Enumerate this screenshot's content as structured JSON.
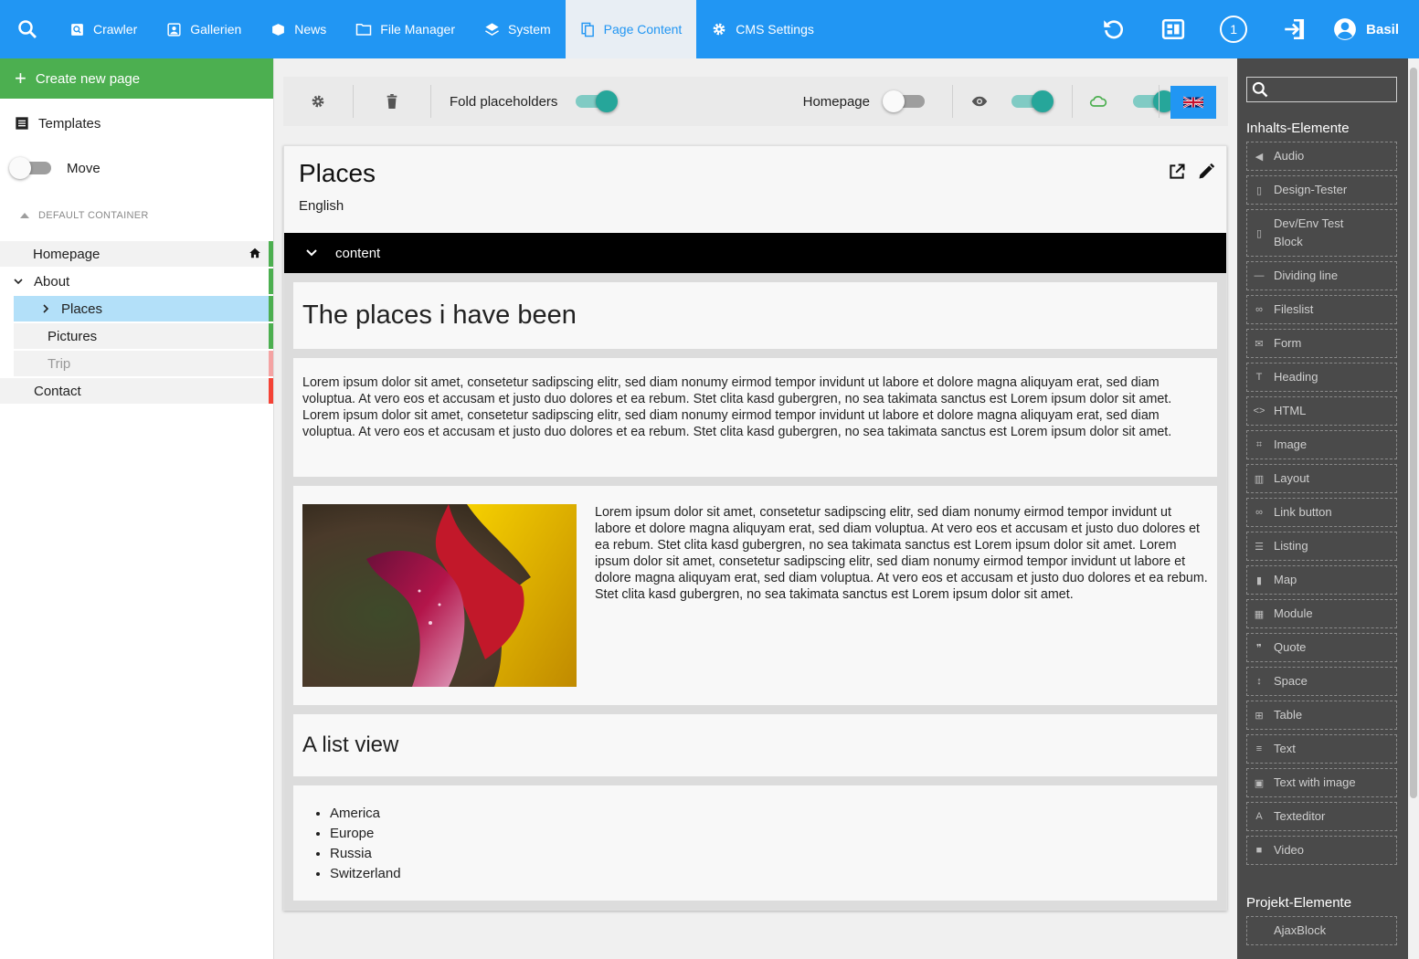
{
  "topbar": {
    "nav": [
      {
        "label": "Crawler",
        "icon": "crawler-icon"
      },
      {
        "label": "Gallerien",
        "icon": "gallery-icon"
      },
      {
        "label": "News",
        "icon": "news-icon"
      },
      {
        "label": "File Manager",
        "icon": "folder-icon"
      },
      {
        "label": "System",
        "icon": "layers-icon"
      },
      {
        "label": "Page Content",
        "icon": "pages-icon",
        "active": true
      },
      {
        "label": "CMS Settings",
        "icon": "gear-icon"
      }
    ],
    "badge_count": "1",
    "user_name": "Basil"
  },
  "sidebar": {
    "create_label": "Create new page",
    "templates_label": "Templates",
    "move_label": "Move",
    "container_label": "DEFAULT CONTAINER",
    "tree": [
      {
        "label": "Homepage"
      },
      {
        "label": "About"
      },
      {
        "label": "Places"
      },
      {
        "label": "Pictures"
      },
      {
        "label": "Trip"
      },
      {
        "label": "Contact"
      }
    ]
  },
  "toolbar": {
    "fold_label": "Fold placeholders",
    "homepage_label": "Homepage"
  },
  "page": {
    "title": "Places",
    "language": "English",
    "section": "content",
    "blocks": {
      "heading": "The places i have been",
      "text1": "Lorem ipsum dolor sit amet, consetetur sadipscing elitr, sed diam nonumy eirmod tempor invidunt ut labore et dolore magna aliquyam erat, sed diam voluptua. At vero eos et accusam et justo duo dolores et ea rebum. Stet clita kasd gubergren, no sea takimata sanctus est Lorem ipsum dolor sit amet. Lorem ipsum dolor sit amet, consetetur sadipscing elitr, sed diam nonumy eirmod tempor invidunt ut labore et dolore magna aliquyam erat, sed diam voluptua. At vero eos et accusam et justo duo dolores et ea rebum. Stet clita kasd gubergren, no sea takimata sanctus est Lorem ipsum dolor sit amet.",
      "text2": "Lorem ipsum dolor sit amet, consetetur sadipscing elitr, sed diam nonumy eirmod tempor invidunt ut labore et dolore magna aliquyam erat, sed diam voluptua. At vero eos et accusam et justo duo dolores et ea rebum. Stet clita kasd gubergren, no sea takimata sanctus est Lorem ipsum dolor sit amet. Lorem ipsum dolor sit amet, consetetur sadipscing elitr, sed diam nonumy eirmod tempor invidunt ut labore et dolore magna aliquyam erat, sed diam voluptua. At vero eos et accusam et justo duo dolores et ea rebum. Stet clita kasd gubergren, no sea takimata sanctus est Lorem ipsum dolor sit amet.",
      "subheading": "A list view",
      "list": [
        "America",
        "Europe",
        "Russia",
        "Switzerland"
      ]
    }
  },
  "panel": {
    "heading": "Inhalts-Elemente",
    "items": [
      {
        "label": "Audio",
        "icon": "volume-icon"
      },
      {
        "label": "Design-Tester",
        "icon": "tester-icon"
      },
      {
        "label": "Dev/Env Test Block",
        "icon": "tester-icon"
      },
      {
        "label": "Dividing line",
        "icon": "minus-icon"
      },
      {
        "label": "Fileslist",
        "icon": "link-icon"
      },
      {
        "label": "Form",
        "icon": "mail-icon"
      },
      {
        "label": "Heading",
        "icon": "text-size-icon"
      },
      {
        "label": "HTML",
        "icon": "code-icon"
      },
      {
        "label": "Image",
        "icon": "crop-icon"
      },
      {
        "label": "Layout",
        "icon": "columns-icon"
      },
      {
        "label": "Link button",
        "icon": "link-icon"
      },
      {
        "label": "Listing",
        "icon": "list-icon"
      },
      {
        "label": "Map",
        "icon": "map-icon"
      },
      {
        "label": "Module",
        "icon": "module-icon"
      },
      {
        "label": "Quote",
        "icon": "quote-icon"
      },
      {
        "label": "Space",
        "icon": "spacing-icon"
      },
      {
        "label": "Table",
        "icon": "table-icon"
      },
      {
        "label": "Text",
        "icon": "text-icon"
      },
      {
        "label": "Text with image",
        "icon": "text-image-icon"
      },
      {
        "label": "Texteditor",
        "icon": "text-format-icon"
      },
      {
        "label": "Video",
        "icon": "video-icon"
      }
    ],
    "heading2": "Projekt-Elemente",
    "project_items": [
      {
        "label": "AjaxBlock"
      }
    ]
  },
  "colors": {
    "primary": "#2196f3",
    "create": "#4caf50",
    "toggle_on": "#26a69a",
    "online": "#4caf50",
    "offline": "#f44336",
    "panel_bg": "#4a4a4a"
  }
}
